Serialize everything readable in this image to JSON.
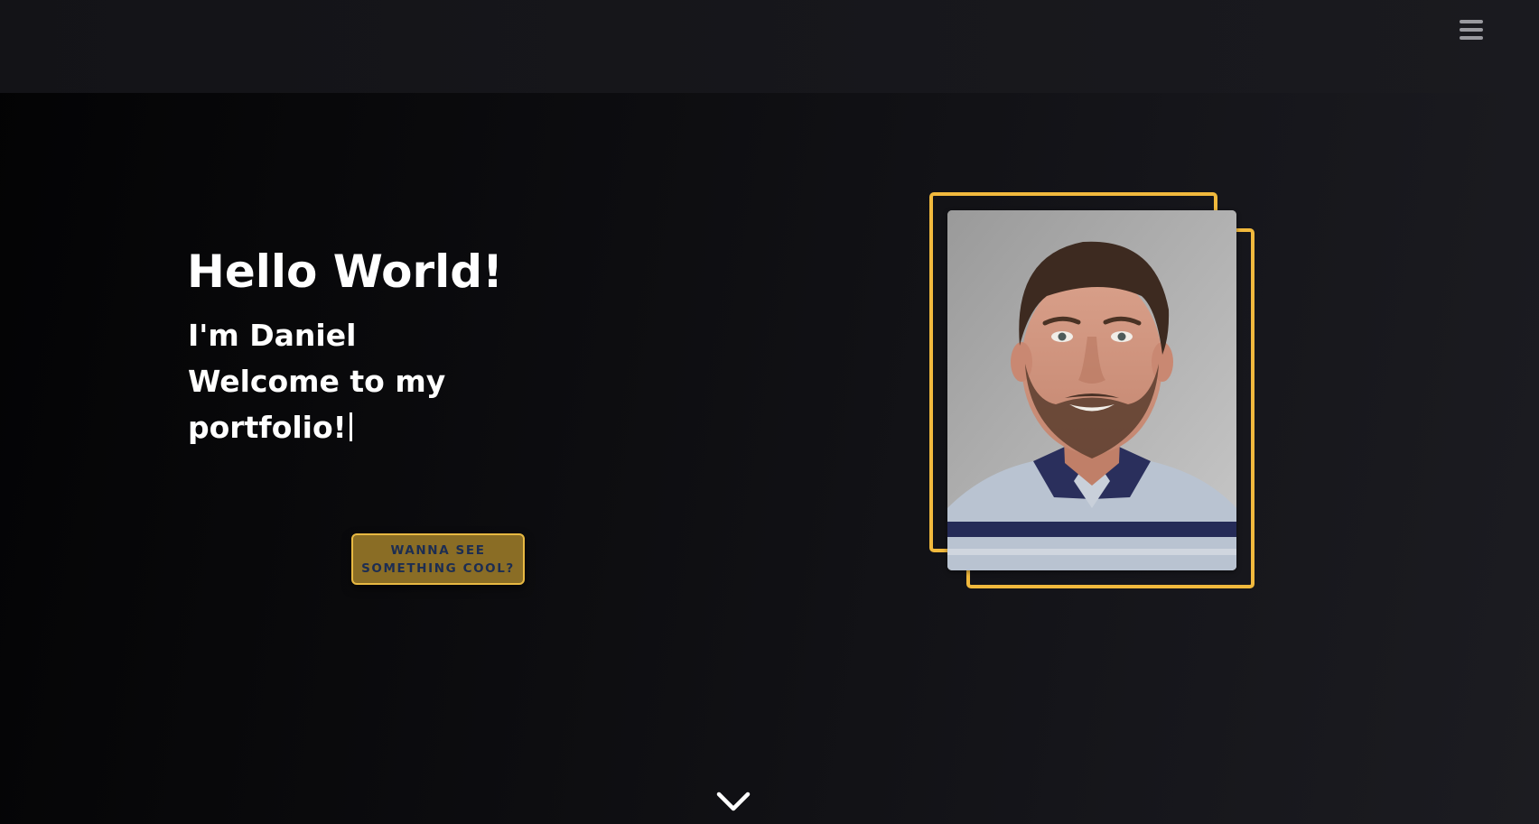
{
  "header": {
    "menu_icon": "hamburger-menu-icon"
  },
  "hero": {
    "greeting": "Hello World!",
    "intro_lines": [
      "I'm Daniel",
      "Welcome to my",
      "portfolio!"
    ],
    "cta_lines": [
      "WANNA SEE",
      "SOMETHING COOL?"
    ],
    "scroll_icon": "chevron-down-icon"
  },
  "colors": {
    "accent": "#f1b93d",
    "button_fill": "#8a6d25",
    "button_text": "#1c2d52",
    "text": "#ffffff",
    "background": "#0d0d10"
  }
}
